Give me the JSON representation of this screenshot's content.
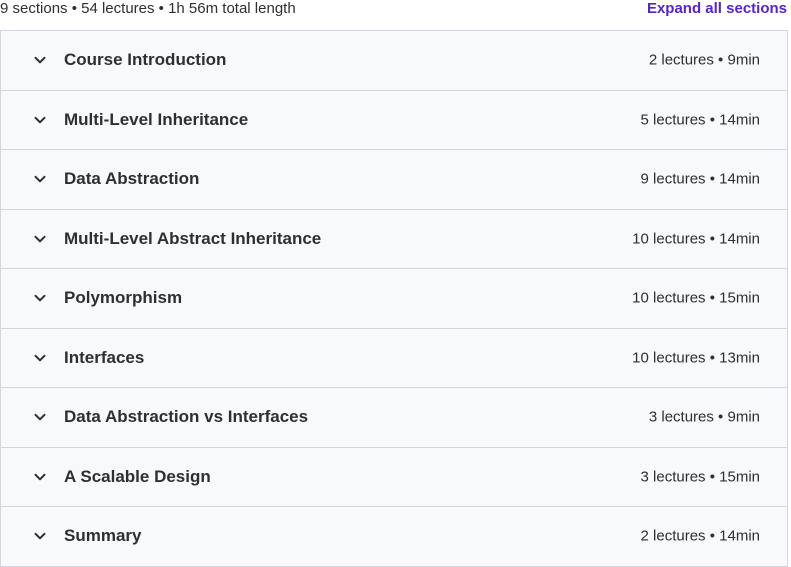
{
  "summary": {
    "text": "9 sections • 54 lectures • 1h 56m total length",
    "expand_label": "Expand all sections"
  },
  "colors": {
    "accent": "#5624d0",
    "row_background": "#f7f9fa",
    "border": "#d1d7dc",
    "text": "#2d2f31"
  },
  "sections": [
    {
      "title": "Course Introduction",
      "meta": "2 lectures • 9min",
      "icon": "chevron-down-icon"
    },
    {
      "title": "Multi-Level Inheritance",
      "meta": "5 lectures • 14min",
      "icon": "chevron-down-icon"
    },
    {
      "title": "Data Abstraction",
      "meta": "9 lectures • 14min",
      "icon": "chevron-down-icon"
    },
    {
      "title": "Multi-Level Abstract Inheritance",
      "meta": "10 lectures • 14min",
      "icon": "chevron-down-icon"
    },
    {
      "title": "Polymorphism",
      "meta": "10 lectures • 15min",
      "icon": "chevron-down-icon"
    },
    {
      "title": "Interfaces",
      "meta": "10 lectures • 13min",
      "icon": "chevron-down-icon"
    },
    {
      "title": "Data Abstraction vs Interfaces",
      "meta": "3 lectures • 9min",
      "icon": "chevron-down-icon"
    },
    {
      "title": "A Scalable Design",
      "meta": "3 lectures • 15min",
      "icon": "chevron-down-icon"
    },
    {
      "title": "Summary",
      "meta": "2 lectures • 14min",
      "icon": "chevron-down-icon"
    }
  ]
}
